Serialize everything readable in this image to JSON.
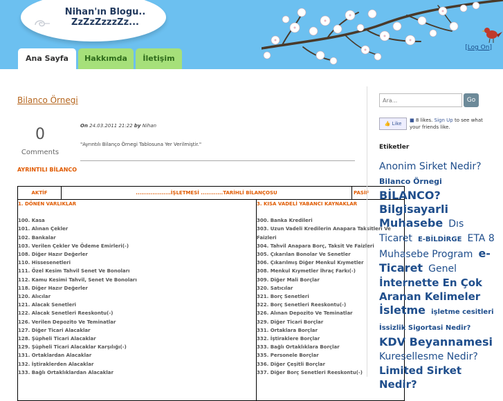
{
  "header": {
    "blog_title_line1": "Nihan'ın Blogu..",
    "blog_title_line2": "ZzZzZzzzZz...",
    "logon_open": "[",
    "logon_label": "Log On",
    "logon_close": "]"
  },
  "tabs": [
    {
      "label": "Ana Sayfa",
      "active": true
    },
    {
      "label": "Hakkımda",
      "active": false
    },
    {
      "label": "İletişim",
      "active": false
    }
  ],
  "post": {
    "title": "Bilanco Örnegi",
    "comment_count": "0",
    "comment_label": "Comments",
    "meta_on": "On",
    "meta_date": "24.03.2011 21:22",
    "meta_by": "by",
    "meta_author": "Nihan",
    "excerpt": "\"Ayrıntılı Bilanço Örnegi Tablosuna Yer Verilmiştir.\"",
    "section_label": "AYRINTILI BİLANCO"
  },
  "balance_table": {
    "header_aktif": "AKTİF",
    "header_middle": "...................İŞLETMESİ ............TARİHLİ BİLANÇOSU",
    "header_pasif": "PASİF",
    "left_heading": "1. DÖNEN VARLIKLAR",
    "right_heading": "3. KISA VADELİ YABANCI KAYNAKLAR",
    "left_items": [
      "100. Kasa",
      "101. Alınan Çekler",
      "102. Bankalar",
      "103. Verilen Çekler Ve Ödeme Emirleri(-)",
      "108. Diğer Hazır Değerler",
      "110. Hissesenetleri",
      "111. Özel Kesim Tahvil Senet Ve Bonoları",
      "112. Kamu Kesimi Tahvil, Senet Ve Bonoları",
      "118. Diğer Hazır Değerler",
      "120. Alıcılar",
      "121. Alacak Senetleri",
      "122. Alacak Senetleri Reeskontu(-)",
      "126. Verilen Depozito Ve Teminatlar",
      "127. Diğer Ticari Alacaklar",
      "128. Şüpheli Ticari Alacaklar",
      "129. Şüpheli Ticari Alacaklar Karşılığı(-)",
      "131. Ortaklardan Alacaklar",
      "132. İştiraklerden Alacaklar",
      "133. Bağlı Ortaklıklardan Alacaklar"
    ],
    "right_items": [
      "300. Banka Kredileri",
      "303. Uzun Vadeli Kredilerin Anapara Taksitleri Ve Faizleri",
      "304. Tahvil Anapara Borç, Taksit Ve Faizleri",
      "305. Çıkarılan Bonolar Ve Senetler",
      "306. Çıkarılmış Diğer Menkul Kıymetler",
      "308. Menkul Kıymetler İhraç Farkı(-)",
      "309. Diğer Mali Borçlar",
      "320. Satıcılar",
      "321. Borç Senetleri",
      "322. Borç Senetleri Reeskontu(-)",
      "326. Alınan Depozito Ve Teminatlar",
      "329. Diğer Ticari Borçlar",
      "331. Ortaklara Borçlar",
      "332. İştiraklere Borçlar",
      "333. Bağlı Ortaklıklara Borçlar",
      "335. Personele Borçlar",
      "336. Diğer Çeşitli Borçlar",
      "337. Diğer Borç Senetleri Reeskontu(-)"
    ]
  },
  "sidebar": {
    "search_placeholder": "Ara...",
    "go_label": "Go",
    "like_label": "Like",
    "like_count_text": "8 likes.",
    "signup_label": "Sign Up",
    "like_suffix": "to see what your friends like.",
    "tags_title": "Etiketler",
    "tags": [
      {
        "label": "Anonim Sirket Nedir?",
        "size": 14,
        "bold": false
      },
      {
        "label": "Bilanco Örnegi",
        "size": 11,
        "bold": true
      },
      {
        "label": "BİLANCO?",
        "size": 16,
        "bold": true
      },
      {
        "label": "Bilgisayarli Muhasebe",
        "size": 16,
        "bold": true
      },
      {
        "label": "Dıs Ticaret",
        "size": 14,
        "bold": false
      },
      {
        "label": "E-BİLDİRGE",
        "size": 10,
        "bold": true
      },
      {
        "label": "ETA 8 Muhasebe Program",
        "size": 14,
        "bold": false
      },
      {
        "label": "e-Ticaret",
        "size": 16,
        "bold": true
      },
      {
        "label": "Genel",
        "size": 14,
        "bold": false
      },
      {
        "label": "İnternette En Çok Aranan Kelimeler",
        "size": 15,
        "bold": true
      },
      {
        "label": "İsletme",
        "size": 16,
        "bold": true
      },
      {
        "label": "işletme cesitleri",
        "size": 10,
        "bold": true
      },
      {
        "label": "İssizlik Sigortasi Nedir?",
        "size": 10,
        "bold": true
      },
      {
        "label": "KDV Beyannamesi",
        "size": 16,
        "bold": true
      },
      {
        "label": "Kuresellesme Nedir?",
        "size": 14,
        "bold": false
      },
      {
        "label": "Limited Sirket Nedir?",
        "size": 15,
        "bold": true
      }
    ]
  }
}
